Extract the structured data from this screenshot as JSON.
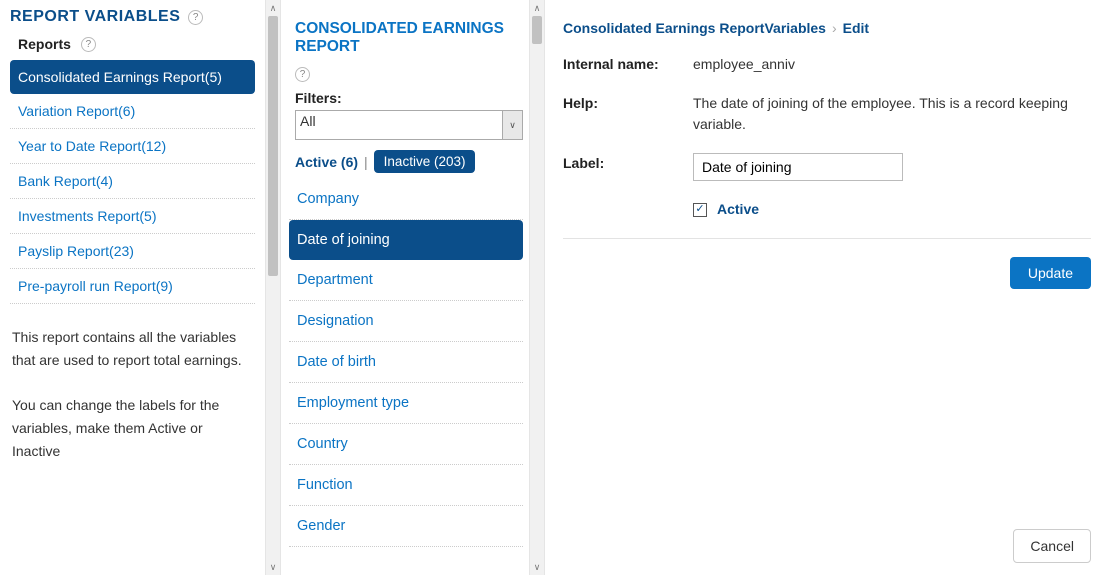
{
  "page_title": "REPORT VARIABLES",
  "tab_label": "Reports",
  "reports": [
    {
      "label": "Consolidated Earnings Report(5)",
      "active": true
    },
    {
      "label": "Variation Report(6)",
      "active": false
    },
    {
      "label": "Year to Date Report(12)",
      "active": false
    },
    {
      "label": "Bank Report(4)",
      "active": false
    },
    {
      "label": "Investments Report(5)",
      "active": false
    },
    {
      "label": "Payslip Report(23)",
      "active": false
    },
    {
      "label": "Pre-payroll run Report(9)",
      "active": false
    }
  ],
  "sidebar_desc_1": "This report contains all the variables that are used to report total earnings.",
  "sidebar_desc_2": "You can change the labels for the variables, make them Active or Inactive",
  "middle": {
    "title": "CONSOLIDATED EARNINGS REPORT",
    "filters_label": "Filters:",
    "filter_value": "All",
    "active_label": "Active (6)",
    "inactive_label": "Inactive (203)",
    "variables": [
      {
        "label": "Company",
        "selected": false
      },
      {
        "label": "Date of joining",
        "selected": true
      },
      {
        "label": "Department",
        "selected": false
      },
      {
        "label": "Designation",
        "selected": false
      },
      {
        "label": "Date of birth",
        "selected": false
      },
      {
        "label": "Employment type",
        "selected": false
      },
      {
        "label": "Country",
        "selected": false
      },
      {
        "label": "Function",
        "selected": false
      },
      {
        "label": "Gender",
        "selected": false
      }
    ]
  },
  "breadcrumb": {
    "part1": "Consolidated Earnings ReportVariables",
    "part2": "Edit"
  },
  "detail": {
    "internal_name_label": "Internal name:",
    "internal_name_value": "employee_anniv",
    "help_label": "Help:",
    "help_value": "The date of joining of the employee. This is a record keeping variable.",
    "label_label": "Label:",
    "label_value": "Date of joining",
    "active_checkbox_label": "Active",
    "active_checked": true,
    "update_btn": "Update",
    "cancel_btn": "Cancel"
  }
}
